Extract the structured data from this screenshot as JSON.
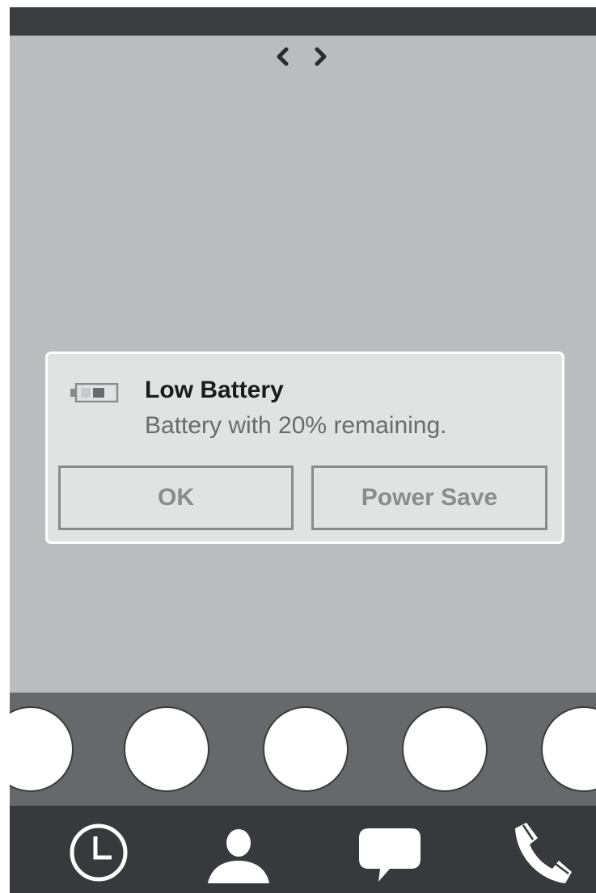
{
  "status_bar": {},
  "page_nav": {
    "prev_icon": "chevron-left-icon",
    "next_icon": "chevron-right-icon"
  },
  "dialog": {
    "icon": "battery-low-icon",
    "title": "Low Battery",
    "message": "Battery with 20% remaining.",
    "ok_label": "OK",
    "power_save_label": "Power Save"
  },
  "dock": {
    "app_count_visible": 5
  },
  "nav_bar": {
    "items": [
      {
        "icon": "clock-icon"
      },
      {
        "icon": "contact-icon"
      },
      {
        "icon": "message-icon"
      },
      {
        "icon": "phone-icon"
      }
    ]
  },
  "colors": {
    "background": "#bbbcbe",
    "status_bar": "#3b3c3e",
    "dialog_bg": "#e1e2e2",
    "button_border": "#8a8b8d",
    "dock_bg": "#676869",
    "nav_bar_bg": "#37393c"
  }
}
